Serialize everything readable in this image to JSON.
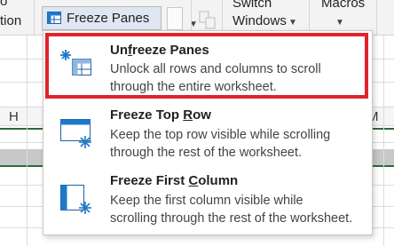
{
  "ribbon": {
    "left_text_top": "o",
    "left_text_bottom": "tion",
    "freeze_panes_label": "Freeze Panes",
    "switch_windows_top": "Switch",
    "switch_windows_bottom": "Windows",
    "macros_label": "Macros"
  },
  "sheet": {
    "col_h": "H",
    "col_m": "M"
  },
  "menu": {
    "items": [
      {
        "title_pre": "Un",
        "title_ul": "f",
        "title_post": "reeze Panes",
        "desc_line1": "Unlock all rows and columns to scroll",
        "desc_line2": "through the entire worksheet.",
        "icon": "unfreeze-panes-icon"
      },
      {
        "title_pre": "Freeze Top ",
        "title_ul": "R",
        "title_post": "ow",
        "desc_line1": "Keep the top row visible while scrolling",
        "desc_line2": "through the rest of the worksheet.",
        "icon": "freeze-top-row-icon"
      },
      {
        "title_pre": "Freeze First ",
        "title_ul": "C",
        "title_post": "olumn",
        "desc_line1": "Keep the first column visible while",
        "desc_line2": "scrolling through the rest of the worksheet.",
        "icon": "freeze-first-column-icon"
      }
    ]
  },
  "colors": {
    "accent_blue": "#1f78c8",
    "highlight_red": "#e0242a",
    "sheet_green": "#2b6a3b"
  }
}
